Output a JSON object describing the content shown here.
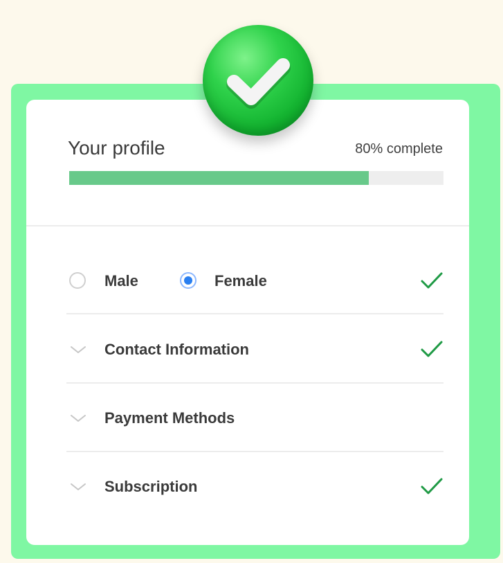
{
  "profile": {
    "title": "Your profile",
    "completion_text": "80% complete",
    "progress_fraction": 0.8
  },
  "gender": {
    "options": [
      {
        "label": "Male",
        "selected": false
      },
      {
        "label": "Female",
        "selected": true
      }
    ],
    "complete": true
  },
  "sections": [
    {
      "label": "Contact Information",
      "complete": true
    },
    {
      "label": "Payment Methods",
      "complete": false
    },
    {
      "label": "Subscription",
      "complete": true
    }
  ],
  "icons": {
    "badge": "check-circle-icon",
    "row_chevron": "chevron-down-icon",
    "row_check": "check-icon"
  },
  "colors": {
    "background": "#fdf9ec",
    "frame": "#7ff7a3",
    "progress": "#68c98a",
    "check": "#1f9a45",
    "radio_selected": "#2a7ff0"
  }
}
